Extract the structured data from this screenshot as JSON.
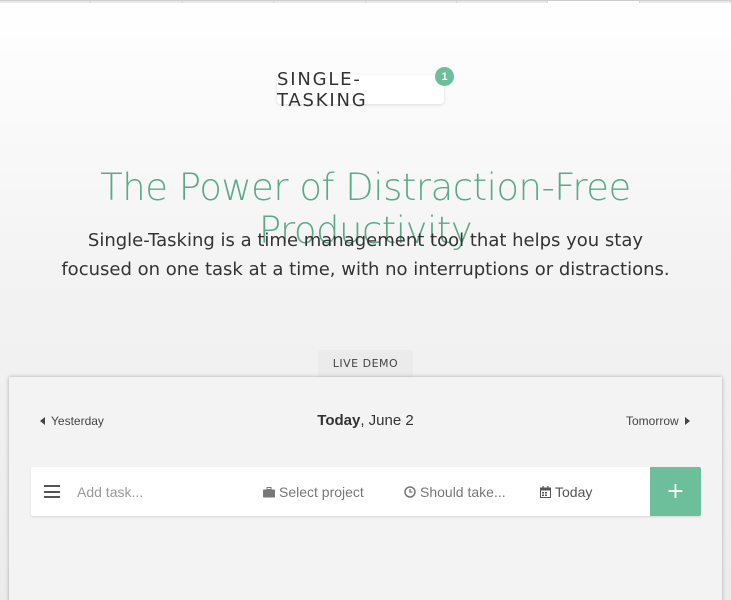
{
  "logo": {
    "text": "SINGLE-TASKING",
    "badge": "1"
  },
  "hero": {
    "headline": "The Power of Distraction-Free Productivity",
    "subtitle": "Single-Tasking is a time management tool that helps you stay focused on one task at a time, with no interruptions or distractions."
  },
  "demo": {
    "tab_label": "LIVE DEMO",
    "nav": {
      "prev_label": "Yesterday",
      "current_bold": "Today",
      "current_rest": ", June 2",
      "next_label": "Tomorrow"
    },
    "task_bar": {
      "input_placeholder": "Add task...",
      "project_label": "Select project",
      "duration_label": "Should take...",
      "date_label": "Today",
      "add_label": "+"
    }
  },
  "colors": {
    "accent": "#6dbf9b",
    "headline": "#5aaa88"
  },
  "icons": {
    "menu": "hamburger-menu-icon",
    "project": "briefcase-icon",
    "duration": "clock-icon",
    "date": "calendar-icon",
    "prev": "caret-left-icon",
    "next": "caret-right-icon",
    "add": "plus-icon"
  }
}
